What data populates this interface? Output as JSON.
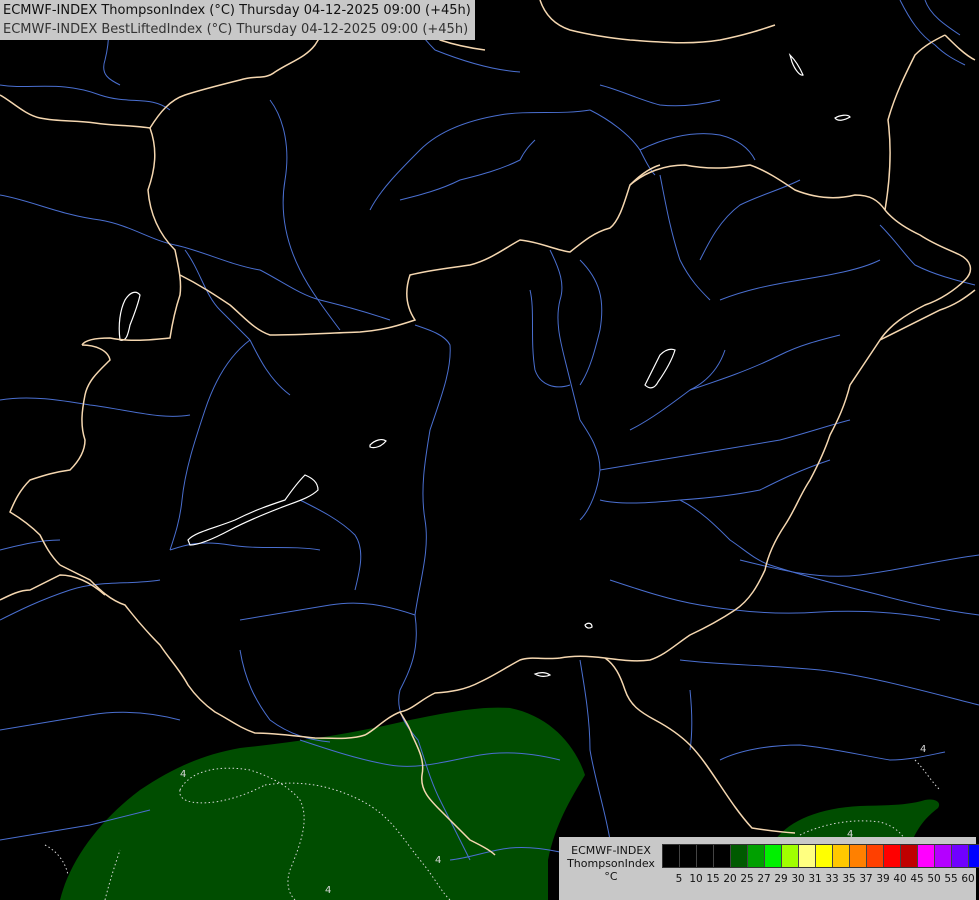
{
  "title": {
    "line1": "ECMWF-INDEX ThompsonIndex (°C) Thursday 04-12-2025 09:00 (+45h)",
    "line2": "ECMWF-INDEX BestLiftedIndex (°C) Thursday 04-12-2025 09:00 (+45h)"
  },
  "legend": {
    "line1": "ECMWF-INDEX",
    "line2": "ThompsonIndex",
    "line3": "°C",
    "ticks": [
      "5",
      "10",
      "15",
      "20",
      "25",
      "27",
      "29",
      "30",
      "31",
      "33",
      "35",
      "37",
      "39",
      "40",
      "45",
      "50",
      "55",
      "60"
    ],
    "colors": [
      "#000000",
      "#000000",
      "#000000",
      "#000000",
      "#005a00",
      "#00a000",
      "#00f000",
      "#a0ff00",
      "#ffff80",
      "#ffff00",
      "#ffc800",
      "#ff8000",
      "#ff4000",
      "#ff0000",
      "#c00000",
      "#ff00ff",
      "#b400ff",
      "#7000ff",
      "#0000ff"
    ]
  },
  "contour_labels": [
    "4",
    "4",
    "4",
    "4",
    "4"
  ],
  "colors": {
    "border": "#f5d7b0",
    "river": "#4a6fd0",
    "lake": "#ffffff",
    "thompson_fill": "#004d00",
    "contour": "#d8d8d8"
  }
}
